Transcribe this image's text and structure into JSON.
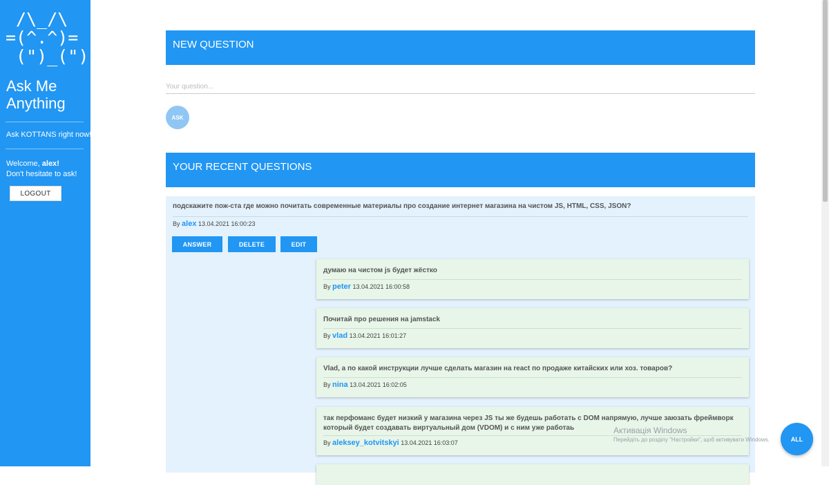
{
  "sidebar": {
    "logo_ascii": " /\\_/\\\n=(^.^)=\n (\")_(\")",
    "title": "Ask Me Anything",
    "tagline": "Ask KOTTANS right now!",
    "welcome_prefix": "Welcome, ",
    "username": "alex",
    "welcome_suffix": "!",
    "welcome_line2": "Don't hesitate to ask!",
    "logout_label": "LOGOUT"
  },
  "new_question": {
    "header": "NEW QUESTION",
    "placeholder": "Your question...",
    "ask_label": "ASK"
  },
  "recent": {
    "header": "YOUR RECENT QUESTIONS"
  },
  "question": {
    "text": "подскажите пож-ста где можно почитать современные материалы про создание интернет магазина на чистом JS, HTML, CSS, JSON?",
    "by": "By",
    "author": "alex",
    "timestamp": "13.04.2021 16:00:23",
    "actions": {
      "answer": "ANSWER",
      "delete": "DELETE",
      "edit": "EDIT"
    }
  },
  "answers": [
    {
      "text": "думаю на чистом js будет жёстко",
      "by": "By",
      "author": "peter",
      "timestamp": "13.04.2021 16:00:58"
    },
    {
      "text": "Почитай про решения на jamstack",
      "by": "By",
      "author": "vlad",
      "timestamp": "13.04.2021 16:01:27"
    },
    {
      "text": "Vlad, а по какой инструкции лучше сделать магазин на react по продаже китайских или хоз. товаров?",
      "by": "By",
      "author": "nina",
      "timestamp": "13.04.2021 16:02:05"
    },
    {
      "text": "так перфоманс будет низкий у магазина через JS ты же будешь работать с DOM напрямую, лучше заюзать фреймворк который будет создавать виртуальный дом (VDOM) и с ним уже работаь",
      "by": "By",
      "author": "aleksey_kotvitskyi",
      "timestamp": "13.04.2021 16:03:07"
    }
  ],
  "fab": {
    "all_label": "ALL"
  },
  "watermark": {
    "title": "Активація Windows",
    "subtitle": "Перейдіть до розділу \"Настройки\", щоб активувати Windows."
  },
  "colors": {
    "primary": "#2196f3",
    "question_bg": "#e3f2fd",
    "answer_bg": "#e8f5e9"
  }
}
